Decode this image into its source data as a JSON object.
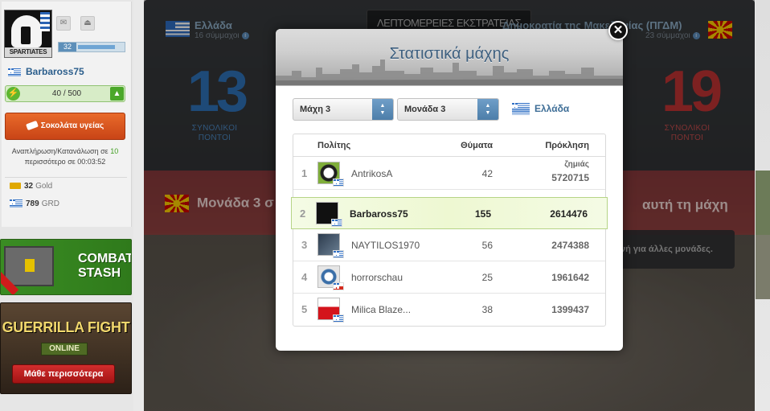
{
  "sidebar": {
    "avatar_tag": "SPARTIATES",
    "level": "32",
    "username": "Barbaross75",
    "energy": "40 / 500",
    "chocolate_label": "Σοκολάτα υγείας",
    "recharge_line1": "Αναπλήρωση/Κατανάλωση σε",
    "recharge_count": "10",
    "recharge_line2_prefix": "περισσότερο σε",
    "recharge_time": "00:03:52",
    "gold_value": "32",
    "gold_label": "Gold",
    "grd_value": "789",
    "grd_label": "GRD",
    "ad1_line1": "COMBAT",
    "ad1_line2": "STASH",
    "ad2_title": "GUERRILLA FIGHT",
    "ad2_badge": "ONLINE",
    "ad2_button": "Μάθε περισσότερα"
  },
  "background": {
    "title": "ΛΕΠΤΟΜΕΡΕΙΕΣ ΕΚΣΤΡΑΤΕΙΑΣ",
    "left_team": "Ελλάδα",
    "left_allies": "16 σύμμαχοι",
    "right_team": "Δημοκρατία της Μακεδονίας (ΠΓΔΜ)",
    "right_allies": "23 σύμμαχοι",
    "left_score": "13",
    "right_score": "19",
    "score_label_1": "ΣΥΝΟΛΙΚΟΙ",
    "score_label_2": "ΠΟΝΤΟΙ",
    "banner_left": "Μονάδα 3 σ",
    "banner_right": "αυτή τη μάχη",
    "note": "νή για άλλες μονάδες."
  },
  "modal": {
    "title": "Στατιστικά μάχης",
    "battle_select": "Μάχη 3",
    "unit_select": "Μονάδα 3",
    "country": "Ελλάδα",
    "columns": {
      "citizen": "Πολίτης",
      "kills": "Θύματα",
      "damage": "Πρόκληση",
      "damage_sub": "ζημιάς"
    },
    "rows": [
      {
        "rank": "1",
        "name": "AntrikosA",
        "kills": "42",
        "damage": "5720715"
      },
      {
        "rank": "2",
        "name": "Barbaross75",
        "kills": "155",
        "damage": "2614476"
      },
      {
        "rank": "3",
        "name": "NAYTILOS1970",
        "kills": "56",
        "damage": "2474388"
      },
      {
        "rank": "4",
        "name": "horrorschau",
        "kills": "25",
        "damage": "1961642"
      },
      {
        "rank": "5",
        "name": "Milica Blaze...",
        "kills": "38",
        "damage": "1399437"
      }
    ]
  },
  "colors": {
    "accent": "#3d6d96",
    "highlight_row": "#eef8d2",
    "energy_green": "#5db631",
    "danger": "#c94416"
  },
  "icons": [
    "mail-icon",
    "upload-icon",
    "energy-bolt-icon",
    "arrow-up-icon",
    "chocolate-icon",
    "gold-icon",
    "close-icon",
    "dropdown-arrow-icon"
  ]
}
